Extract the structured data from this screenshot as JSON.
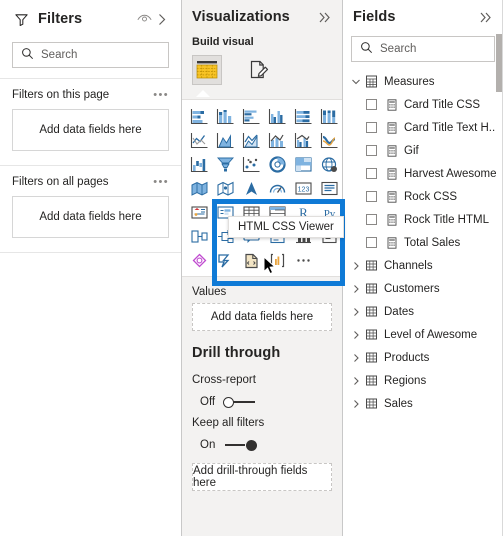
{
  "filters": {
    "title": "Filters",
    "eye_icon": "eye-icon",
    "expand_icon": "chevron-right-icon",
    "search_placeholder": "Search",
    "search_icon": "search-icon",
    "sections": [
      {
        "label": "Filters on this page",
        "menu": "•••",
        "dropzone": "Add data fields here"
      },
      {
        "label": "Filters on all pages",
        "menu": "•••",
        "dropzone": "Add data fields here"
      }
    ]
  },
  "visualizations": {
    "title": "Visualizations",
    "collapse_icon": "double-chevron-right-icon",
    "build_label": "Build visual",
    "build_buttons": [
      {
        "name": "table-visual-button",
        "selected": true
      },
      {
        "name": "format-page-button",
        "selected": false
      }
    ],
    "gallery": [
      "stacked-bar-chart-icon",
      "stacked-column-chart-icon",
      "clustered-bar-chart-icon",
      "clustered-column-chart-icon",
      "100-stacked-bar-chart-icon",
      "100-stacked-column-chart-icon",
      "line-chart-icon",
      "area-chart-icon",
      "stacked-area-chart-icon",
      "line-stacked-column-chart-icon",
      "line-clustered-column-chart-icon",
      "ribbon-chart-icon",
      "waterfall-chart-icon",
      "funnel-chart-icon",
      "scatter-chart-icon",
      "pie-chart-icon",
      "treemap-icon",
      "map-icon",
      "filled-map-icon",
      "shape-map-icon",
      "azure-map-icon",
      "gauge-chart-icon",
      "card-icon",
      "multi-row-card-icon",
      "kpi-icon",
      "slicer-icon",
      "table-icon",
      "matrix-icon",
      "r-script-visual-icon",
      "py-visual-icon",
      "key-influencers-icon",
      "decomposition-tree-icon",
      "q-and-a-icon",
      "smart-narrative-icon",
      "metrics-icon",
      "paginated-report-icon",
      "arcgis-maps-icon",
      "power-apps-icon",
      "visio-icon",
      "html-css-viewer-icon",
      "charticulator-icon",
      "more-options-icon"
    ],
    "values_label": "Values",
    "values_dropzone": "Add data fields here",
    "drill_title": "Drill through",
    "cross_report_label": "Cross-report",
    "cross_report_state": "Off",
    "keep_filters_label": "Keep all filters",
    "keep_filters_state": "On",
    "drill_dropzone": "Add drill-through fields here"
  },
  "tooltip": {
    "text": "HTML CSS Viewer"
  },
  "fields": {
    "title": "Fields",
    "collapse_icon": "double-chevron-right-icon",
    "search_placeholder": "Search",
    "search_icon": "search-icon",
    "measures_group": {
      "label": "Measures",
      "icon": "measures-table-icon",
      "expanded": true
    },
    "measures": [
      {
        "label": "Card Title CSS",
        "icon": "measure-icon",
        "checked": false
      },
      {
        "label": "Card Title Text H..",
        "icon": "measure-icon",
        "checked": false
      },
      {
        "label": "Gif",
        "icon": "measure-icon",
        "checked": false
      },
      {
        "label": "Harvest Awesome",
        "icon": "measure-icon",
        "checked": false
      },
      {
        "label": "Rock CSS",
        "icon": "measure-icon",
        "checked": false
      },
      {
        "label": "Rock Title HTML",
        "icon": "measure-icon",
        "checked": false
      },
      {
        "label": "Total Sales",
        "icon": "measure-icon",
        "checked": false
      }
    ],
    "tables": [
      {
        "label": "Channels",
        "icon": "table-icon",
        "expanded": false
      },
      {
        "label": "Customers",
        "icon": "table-icon",
        "expanded": false
      },
      {
        "label": "Dates",
        "icon": "table-icon",
        "expanded": false
      },
      {
        "label": "Level of Awesome",
        "icon": "table-icon",
        "expanded": false
      },
      {
        "label": "Products",
        "icon": "table-icon",
        "expanded": false
      },
      {
        "label": "Regions",
        "icon": "table-icon",
        "expanded": false
      },
      {
        "label": "Sales",
        "icon": "table-icon",
        "expanded": false
      }
    ]
  },
  "colors": {
    "highlight_blue": "#0f7ad6",
    "viz_icon_blue": "#3f8ed0",
    "viz_icon_dark": "#4a4a4a",
    "build_yellow": "#f5c518",
    "pane_bg": "#f3f2f1"
  }
}
